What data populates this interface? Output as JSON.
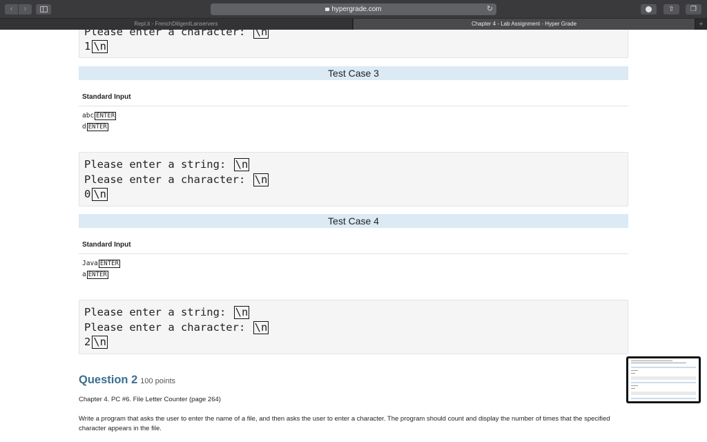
{
  "browser": {
    "url": "hypergrade.com",
    "tabs": [
      {
        "title": "Repl.it - FrenchDiligentLanservers"
      },
      {
        "title": "Chapter 4 - Lab Assignment - Hyper Grade"
      }
    ],
    "new_tab_symbol": "+"
  },
  "icons": {
    "back": "chevron-left-icon",
    "forward": "chevron-right-icon",
    "sidebar": "sidebar-icon",
    "lock": "lock-icon",
    "reload": "reload-icon",
    "download": "download-icon",
    "share": "share-icon",
    "tabs": "tabs-overview-icon"
  },
  "top_output": {
    "partial_line": "Please enter a character: ",
    "nl": "\\n",
    "line": "1"
  },
  "test_case_3": {
    "title": "Test Case 3",
    "input_label": "Standard Input",
    "inputs": [
      {
        "text": "abc",
        "key": "ENTER"
      },
      {
        "text": "d",
        "key": "ENTER"
      }
    ],
    "output": [
      {
        "text": "Please enter a string: ",
        "nl": "\\n"
      },
      {
        "text": "Please enter a character: ",
        "nl": "\\n"
      },
      {
        "text": "0",
        "nl": "\\n"
      }
    ]
  },
  "test_case_4": {
    "title": "Test Case 4",
    "input_label": "Standard Input",
    "inputs": [
      {
        "text": "Java",
        "key": "ENTER"
      },
      {
        "text": "a",
        "key": "ENTER"
      }
    ],
    "output": [
      {
        "text": "Please enter a string: ",
        "nl": "\\n"
      },
      {
        "text": "Please enter a character: ",
        "nl": "\\n"
      },
      {
        "text": "2",
        "nl": "\\n"
      }
    ]
  },
  "question": {
    "title": "Question 2",
    "points": "100 points",
    "subtitle": "Chapter 4. PC #6. File Letter Counter (page 264)",
    "description": "Write a program that asks the user to enter the name of a file, and then asks the user to enter a character. The program should count and display the number of times that the specified character appears in the file."
  },
  "colors": {
    "toolbar": "#3a3a3c",
    "test_case_header": "#dbeaf5",
    "question_title": "#3a6e8f",
    "output_bg": "#f5f5f5"
  }
}
